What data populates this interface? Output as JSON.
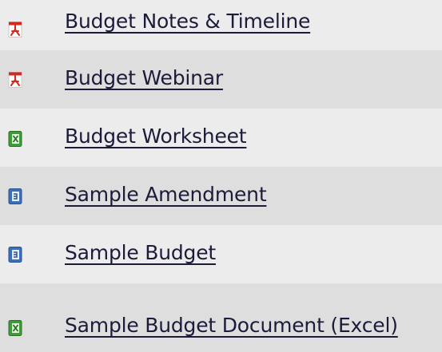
{
  "documents": [
    {
      "label": "Budget Notes & Timeline",
      "icon": "pdf-icon"
    },
    {
      "label": "Budget Webinar",
      "icon": "pdf-icon"
    },
    {
      "label": "Budget Worksheet",
      "icon": "excel-icon"
    },
    {
      "label": "Sample Amendment",
      "icon": "word-icon"
    },
    {
      "label": "Sample Budget",
      "icon": "word-icon"
    },
    {
      "label": "Sample Budget Document (Excel)",
      "icon": "excel-icon"
    }
  ],
  "colors": {
    "link": "#1c1c3a",
    "row_light": "#ececec",
    "row_dark": "#dedede",
    "pdf": "#d42a1c",
    "excel": "#3f9a3a",
    "word": "#3b6fb8"
  }
}
